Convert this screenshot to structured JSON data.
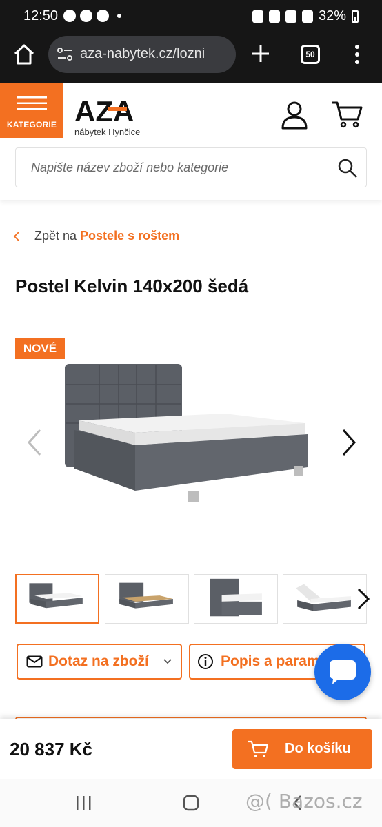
{
  "status_bar": {
    "time": "12:50",
    "battery": "32%"
  },
  "browser": {
    "url": "aza-nabytek.cz/lozni",
    "tab_count": "50"
  },
  "header": {
    "menu_label": "KATEGORIE",
    "logo_text": "AZA",
    "logo_tagline": "nábytek Hynčice",
    "search_placeholder": "Napište název zboží nebo kategorie"
  },
  "breadcrumb": {
    "prefix": "Zpět na",
    "link": "Postele s roštem"
  },
  "product": {
    "title": "Postel Kelvin 140x200 šedá",
    "badge": "NOVÉ",
    "price": "20 837 Kč"
  },
  "actions": {
    "inquiry": "Dotaz na zboží",
    "description": "Popis a param"
  },
  "cart": {
    "add_label": "Do košíku"
  },
  "watermark": "@( Bazos.cz",
  "colors": {
    "accent": "#f37021",
    "chat": "#1c6ce8",
    "dark_bar": "#161616"
  }
}
